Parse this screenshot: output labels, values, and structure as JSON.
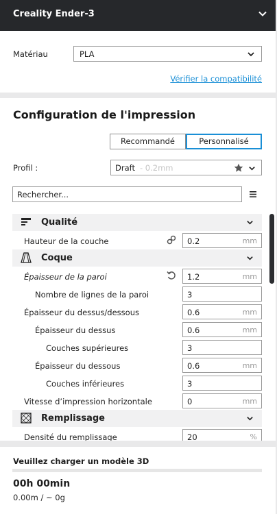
{
  "header": {
    "printer_name": "Creality Ender-3"
  },
  "material": {
    "label": "Matériau",
    "selected": "PLA",
    "check_link": "Vérifier la compatibilité"
  },
  "print_setup": {
    "title": "Configuration de l'impression",
    "tabs": {
      "recommended": "Recommandé",
      "custom": "Personnalisé",
      "active": "custom"
    },
    "profile_label": "Profil :",
    "profile_name": "Draft",
    "profile_sub": "- 0.2mm",
    "search_placeholder": "Rechercher..."
  },
  "settings": {
    "quality": {
      "title": "Qualité",
      "layer_height": {
        "label": "Hauteur de la couche",
        "value": "0.2",
        "unit": "mm"
      }
    },
    "shell": {
      "title": "Coque",
      "wall_thickness": {
        "label": "Épaisseur de la paroi",
        "value": "1.2",
        "unit": "mm"
      },
      "wall_line_count": {
        "label": "Nombre de lignes de la paroi",
        "value": "3"
      },
      "top_bottom_thickness": {
        "label": "Épaisseur du dessus/dessous",
        "value": "0.6",
        "unit": "mm"
      },
      "top_thickness": {
        "label": "Épaisseur du dessus",
        "value": "0.6",
        "unit": "mm"
      },
      "top_layers": {
        "label": "Couches supérieures",
        "value": "3"
      },
      "bottom_thickness": {
        "label": "Épaisseur du dessous",
        "value": "0.6",
        "unit": "mm"
      },
      "bottom_layers": {
        "label": "Couches inférieures",
        "value": "3"
      },
      "horizontal_speed": {
        "label": "Vitesse d’impression horizontale",
        "value": "0",
        "unit": "mm"
      }
    },
    "infill": {
      "title": "Remplissage",
      "density": {
        "label": "Densité du remplissage",
        "value": "20",
        "unit": "%"
      }
    }
  },
  "job": {
    "status": "Veuillez charger un modèle 3D",
    "time": "00h 00min",
    "material_usage": "0.00m / ~ 0g"
  },
  "colors": {
    "accent": "#1a8fd6",
    "header_bg": "#26282b"
  }
}
